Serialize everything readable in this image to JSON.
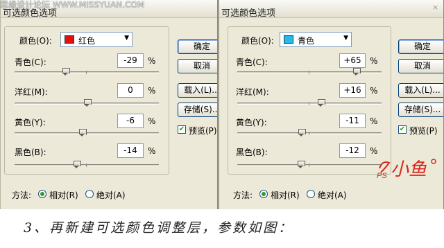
{
  "watermark": "思缘设计论坛 WWW.MISSYUAN.COM",
  "left_dialog": {
    "title": "可选颜色选项",
    "color_label": "颜色(O):",
    "color_value": "红色",
    "color_swatch": "#dd1111",
    "sliders": [
      {
        "label": "青色(C):",
        "value": "-29",
        "percent": -29
      },
      {
        "label": "洋红(M):",
        "value": "0",
        "percent": 0
      },
      {
        "label": "黄色(Y):",
        "value": "-6",
        "percent": -6
      },
      {
        "label": "黑色(B):",
        "value": "-14",
        "percent": -14
      }
    ],
    "pct_symbol": "%",
    "buttons": {
      "ok": "确定",
      "cancel": "取消",
      "load": "载入(L)...",
      "save": "存储(S)..."
    },
    "preview_label": "预览(P)",
    "preview_checked": true,
    "method_label": "方法:",
    "method_relative": "相对(R)",
    "method_absolute": "绝对(A)",
    "method_selected": "relative"
  },
  "right_dialog": {
    "title": "可选颜色选项",
    "color_label": "颜色(O):",
    "color_value": "青色",
    "color_swatch": "#27b9ea",
    "sliders": [
      {
        "label": "青色(C):",
        "value": "+65",
        "percent": 65
      },
      {
        "label": "洋红(M):",
        "value": "+16",
        "percent": 16
      },
      {
        "label": "黄色(Y):",
        "value": "-11",
        "percent": -11
      },
      {
        "label": "黑色(B):",
        "value": "-12",
        "percent": -12
      }
    ],
    "pct_symbol": "%",
    "buttons": {
      "ok": "确定",
      "cancel": "取消",
      "load": "载入(L)...",
      "save": "存储(S)..."
    },
    "preview_label": "预览(P)",
    "preview_checked": true,
    "method_label": "方法:",
    "method_relative": "相对(R)",
    "method_absolute": "绝对(A)",
    "method_selected": "relative"
  },
  "caption": "3、再新建可选颜色调整层，参数如图：",
  "logo": {
    "text": "小鱼",
    "prefix": "PS",
    "color": "#d9261c"
  }
}
